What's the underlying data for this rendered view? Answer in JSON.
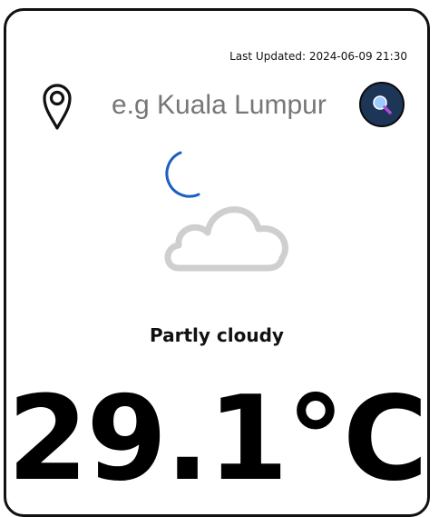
{
  "header": {
    "last_updated": "Last Updated: 2024-06-09 21:30"
  },
  "search": {
    "placeholder": "e.g Kuala Lumpur",
    "value": ""
  },
  "icons": {
    "location": "location-pin-icon",
    "search": "search-magnifier-icon",
    "weather": "night-partly-cloudy-icon"
  },
  "weather": {
    "condition": "Partly cloudy",
    "temperature": "29.1°C"
  },
  "colors": {
    "search_button": "#1d3557",
    "moon": "#1f6fd1",
    "cloud_outline": "#c8c8c8"
  }
}
